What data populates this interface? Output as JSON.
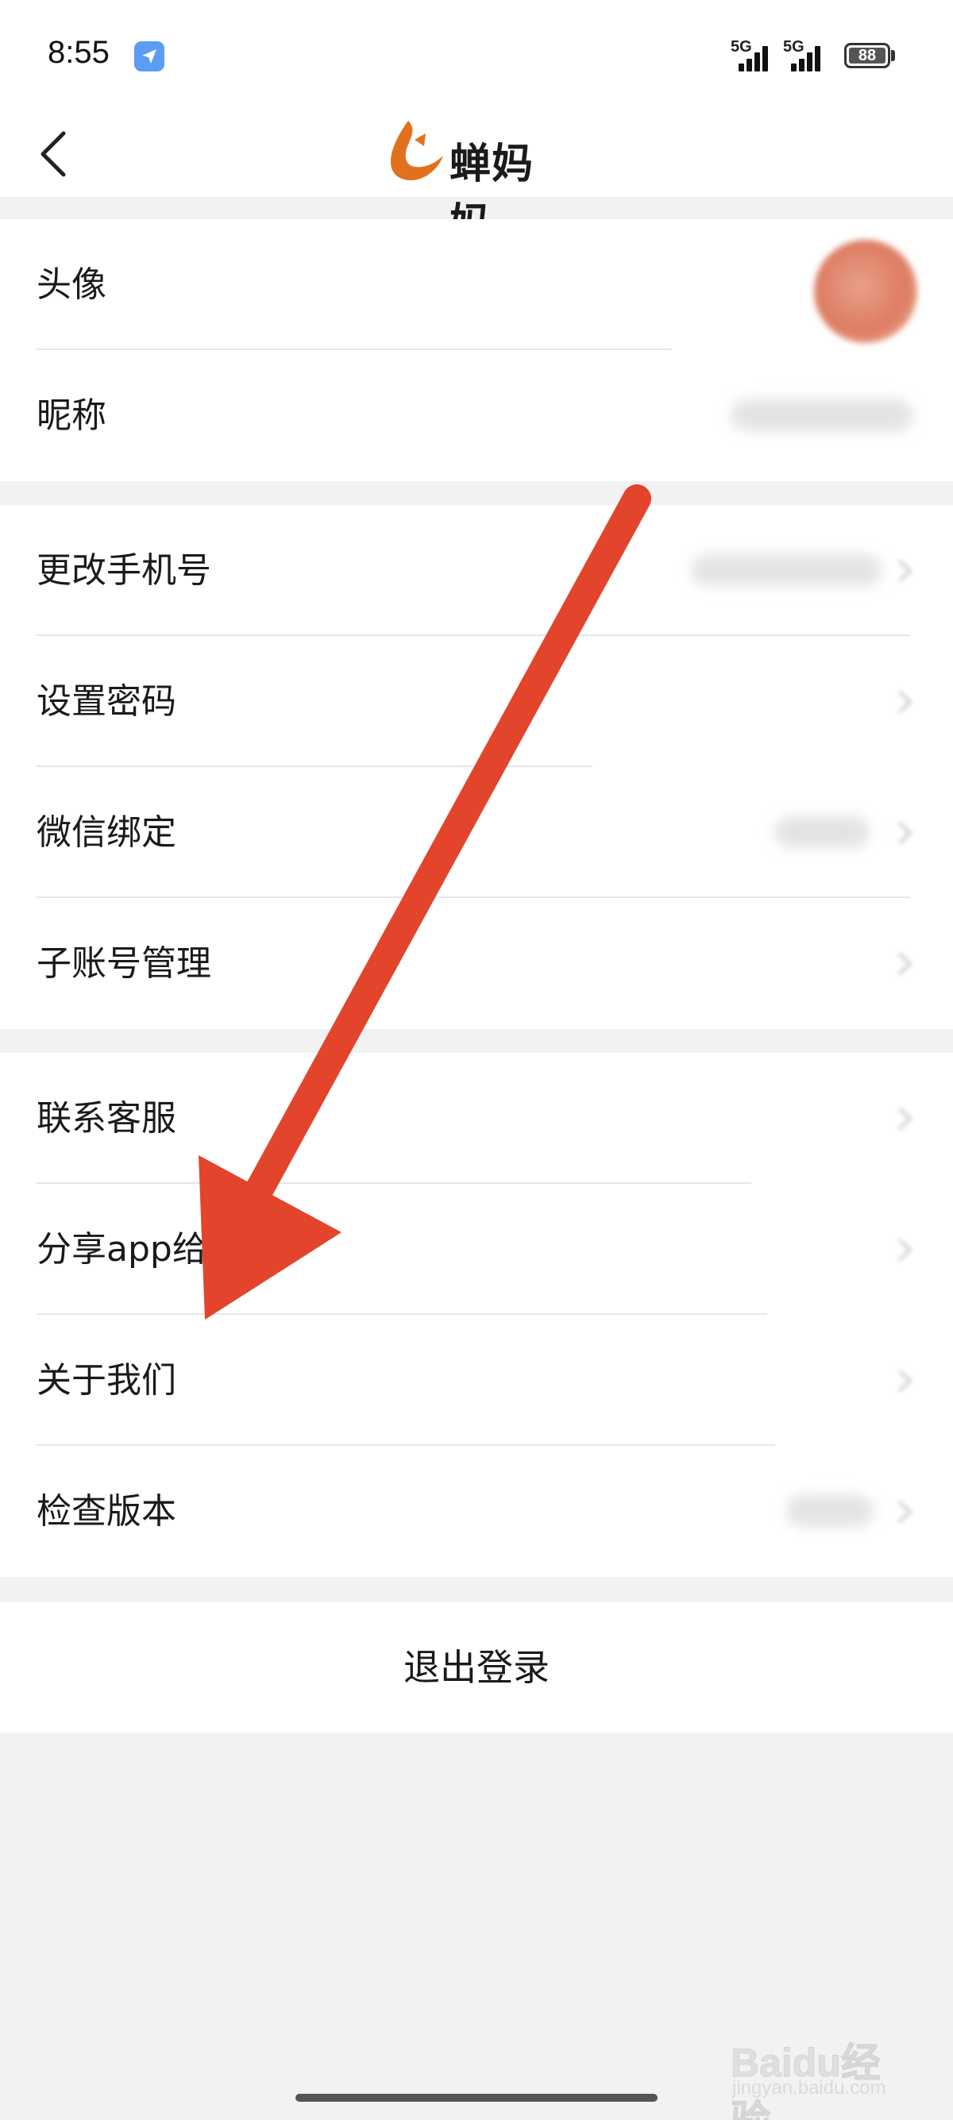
{
  "status_bar": {
    "time": "8:55",
    "signal_1": "5G",
    "signal_2": "5G",
    "battery": "88"
  },
  "header": {
    "app_name": "蝉妈妈"
  },
  "groups": [
    {
      "rows": [
        {
          "label": "头像"
        },
        {
          "label": "昵称"
        }
      ]
    },
    {
      "rows": [
        {
          "label": "更改手机号"
        },
        {
          "label": "设置密码"
        },
        {
          "label": "微信绑定"
        },
        {
          "label": "子账号管理"
        }
      ]
    },
    {
      "rows": [
        {
          "label": "联系客服"
        },
        {
          "label": "分享app给"
        },
        {
          "label": "关于我们"
        },
        {
          "label": "检查版本"
        }
      ]
    }
  ],
  "logout_label": "退出登录",
  "watermark": {
    "text": "Baidu经验",
    "sub": "jingyan.baidu.com"
  },
  "colors": {
    "accent_orange": "#e2711d",
    "arrow_red": "#e2452b",
    "status_app_icon": "#5b9df3"
  }
}
